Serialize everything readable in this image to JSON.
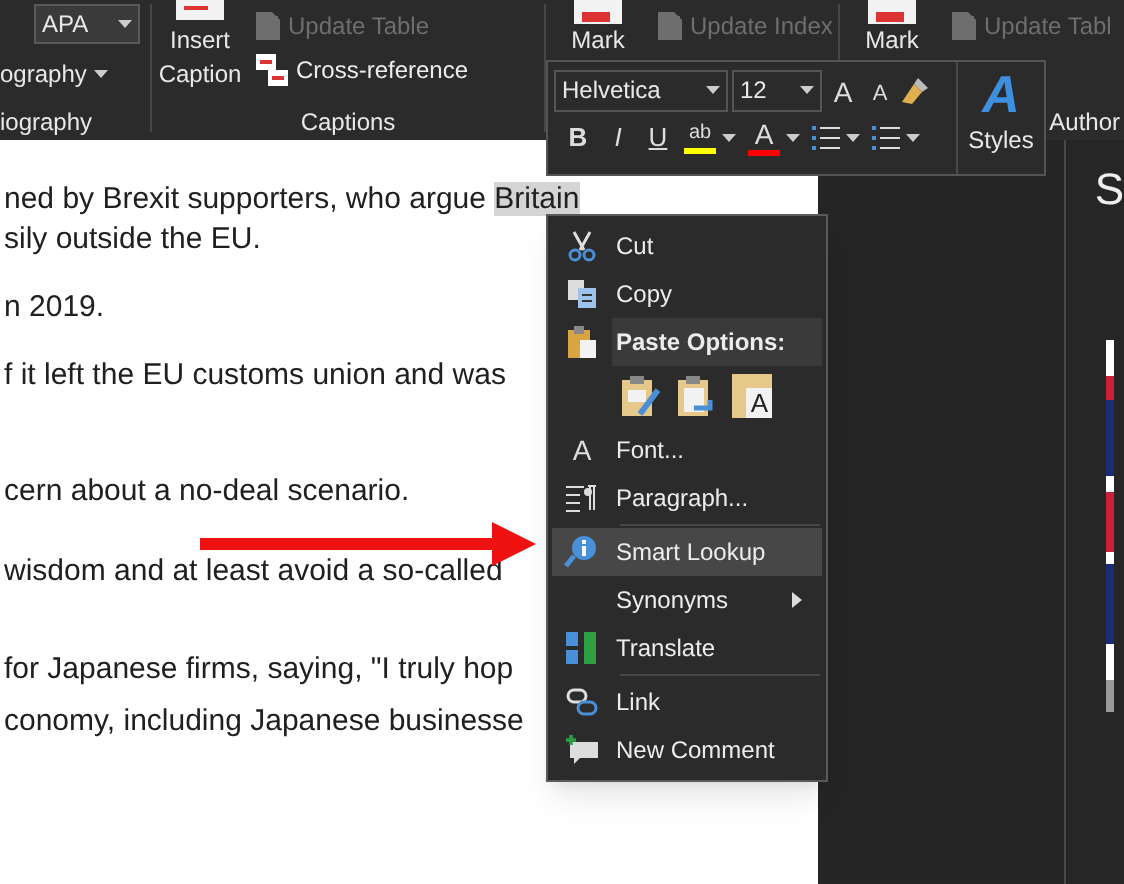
{
  "ribbon": {
    "groups": [
      {
        "kind": "citations",
        "style_value": "APA",
        "button": "ography",
        "label": "iography"
      },
      {
        "kind": "captions",
        "large_button": "Insert Caption",
        "commands": [
          {
            "label": "Update Table",
            "disabled": true
          },
          {
            "label": "Cross-reference",
            "disabled": false
          }
        ],
        "label": "Captions"
      },
      {
        "kind": "index",
        "large_button": "Mark",
        "commands": [
          {
            "label": "Update Index",
            "disabled": true
          }
        ]
      },
      {
        "kind": "authorities",
        "large_button": "Mark",
        "commands": [
          {
            "label": "Update Tabl",
            "disabled": true
          }
        ],
        "label": "Author"
      }
    ]
  },
  "mini_toolbar": {
    "font": "Helvetica",
    "size": "12",
    "grow_font": "A",
    "shrink_font": "A",
    "format_buttons": [
      "B",
      "I",
      "U"
    ],
    "highlight": "ab",
    "font_color": "A",
    "styles_glyph": "A",
    "styles_label": "Styles"
  },
  "document": {
    "paragraphs": [
      {
        "lines": [
          {
            "text": "ned by Brexit supporters, who argue ",
            "selection": "Britain"
          },
          {
            "text": "sily outside the EU."
          }
        ]
      },
      {
        "lines": [
          {
            "text": "n 2019."
          }
        ]
      },
      {
        "lines": [
          {
            "text": "f it left the EU customs union and was"
          }
        ]
      },
      {
        "lines": [
          {
            "text": "cern about a no-deal scenario."
          }
        ]
      },
      {
        "lines": [
          {
            "text": "wisdom and at least avoid a so-called"
          }
        ]
      },
      {
        "lines": [
          {
            "text": "for Japanese firms, saying, \"I truly hop"
          },
          {
            "text": "conomy, including Japanese businesse"
          }
        ]
      }
    ]
  },
  "side_pane": {
    "title": "S"
  },
  "context_menu": {
    "items": [
      {
        "kind": "command",
        "label": "Cut",
        "selected": false
      },
      {
        "kind": "command",
        "label": "Copy",
        "selected": false
      },
      {
        "kind": "header",
        "label": "Paste Options:"
      },
      {
        "kind": "paste_icons",
        "glyph": "A"
      },
      {
        "kind": "command",
        "icon_char": "A",
        "label": "Font...",
        "selected": false
      },
      {
        "kind": "command",
        "label": "Paragraph...",
        "selected": false
      },
      {
        "kind": "command",
        "label": "Smart Lookup",
        "selected": true
      },
      {
        "kind": "submenu",
        "label": "Synonyms",
        "selected": false
      },
      {
        "kind": "command",
        "label": "Translate",
        "selected": false
      },
      {
        "kind": "command",
        "label": "Link",
        "selected": false
      },
      {
        "kind": "command",
        "label": "New Comment",
        "selected": false
      }
    ]
  }
}
